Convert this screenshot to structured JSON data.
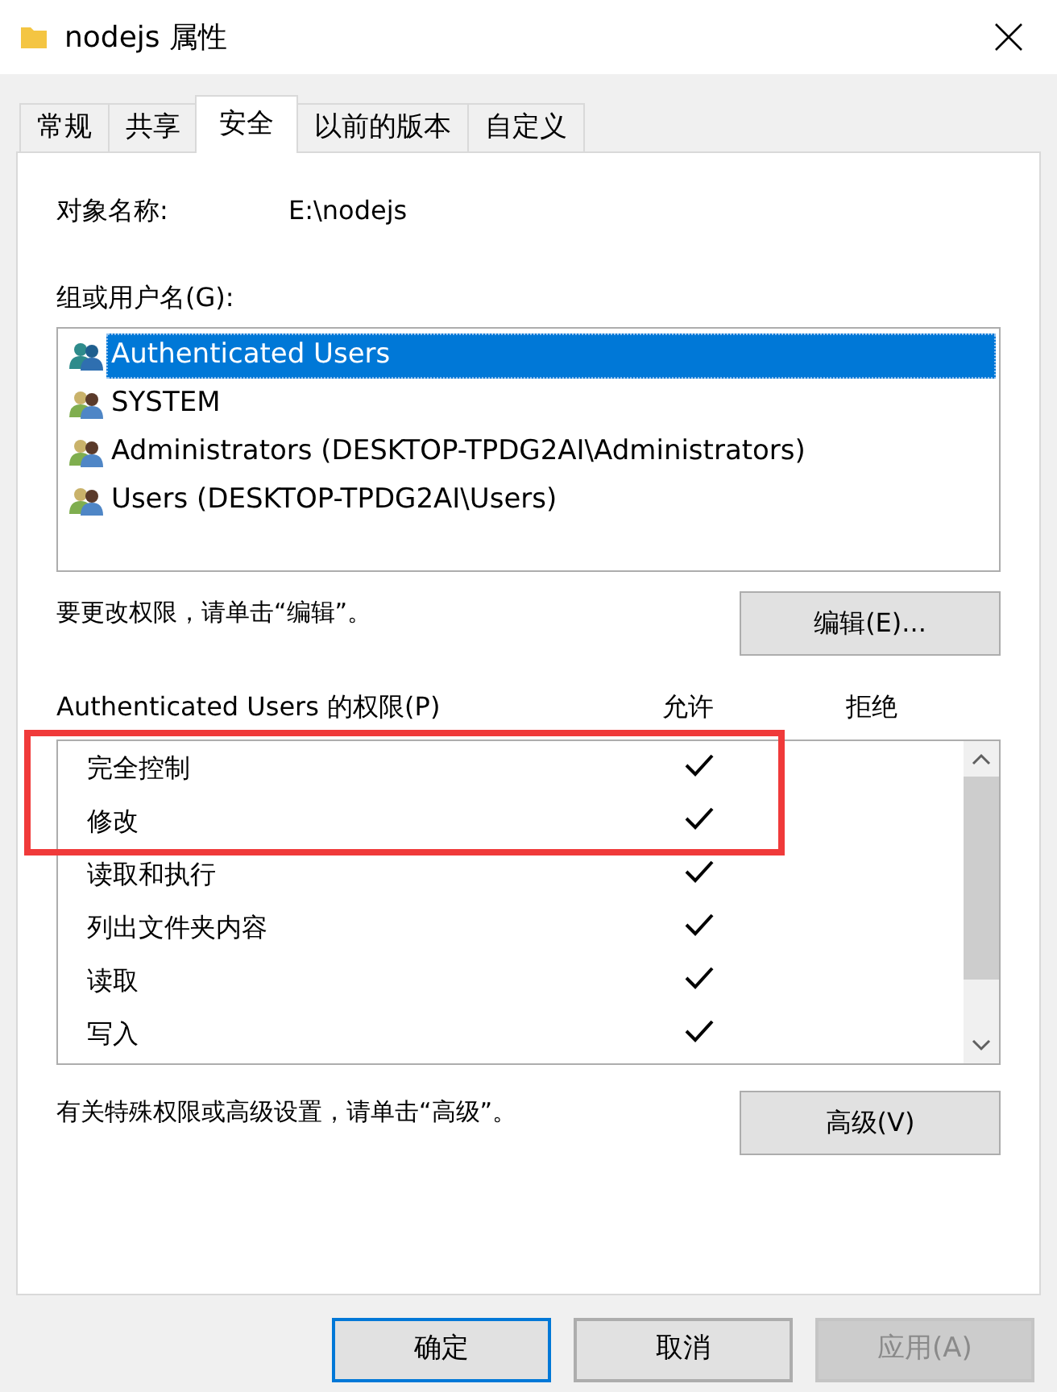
{
  "window": {
    "title": "nodejs 属性"
  },
  "tabs": [
    {
      "label": "常规",
      "selected": false
    },
    {
      "label": "共享",
      "selected": false
    },
    {
      "label": "安全",
      "selected": true
    },
    {
      "label": "以前的版本",
      "selected": false
    },
    {
      "label": "自定义",
      "selected": false
    }
  ],
  "object_name": {
    "label": "对象名称:",
    "value": "E:\\nodejs"
  },
  "groups": {
    "label": "组或用户名(G):",
    "items": [
      {
        "name": "Authenticated Users",
        "selected": true
      },
      {
        "name": "SYSTEM",
        "selected": false
      },
      {
        "name": "Administrators (DESKTOP-TPDG2AI\\Administrators)",
        "selected": false
      },
      {
        "name": "Users (DESKTOP-TPDG2AI\\Users)",
        "selected": false
      }
    ]
  },
  "edit_hint": "要更改权限，请单击“编辑”。",
  "edit_button": "编辑(E)...",
  "permissions": {
    "label": "Authenticated Users 的权限(P)",
    "allow_header": "允许",
    "deny_header": "拒绝",
    "items": [
      {
        "name": "完全控制",
        "allow": true,
        "deny": false,
        "highlighted": true
      },
      {
        "name": "修改",
        "allow": true,
        "deny": false,
        "highlighted": true
      },
      {
        "name": "读取和执行",
        "allow": true,
        "deny": false,
        "highlighted": false
      },
      {
        "name": "列出文件夹内容",
        "allow": true,
        "deny": false,
        "highlighted": false
      },
      {
        "name": "读取",
        "allow": true,
        "deny": false,
        "highlighted": false
      },
      {
        "name": "写入",
        "allow": true,
        "deny": false,
        "highlighted": false
      }
    ]
  },
  "advanced_hint": "有关特殊权限或高级设置，请单击“高级”。",
  "advanced_button": "高级(V)",
  "buttons": [
    {
      "label": "确定",
      "kind": "default",
      "disabled": false
    },
    {
      "label": "取消",
      "kind": "normal",
      "disabled": false
    },
    {
      "label": "应用(A)",
      "kind": "normal",
      "disabled": true
    }
  ]
}
